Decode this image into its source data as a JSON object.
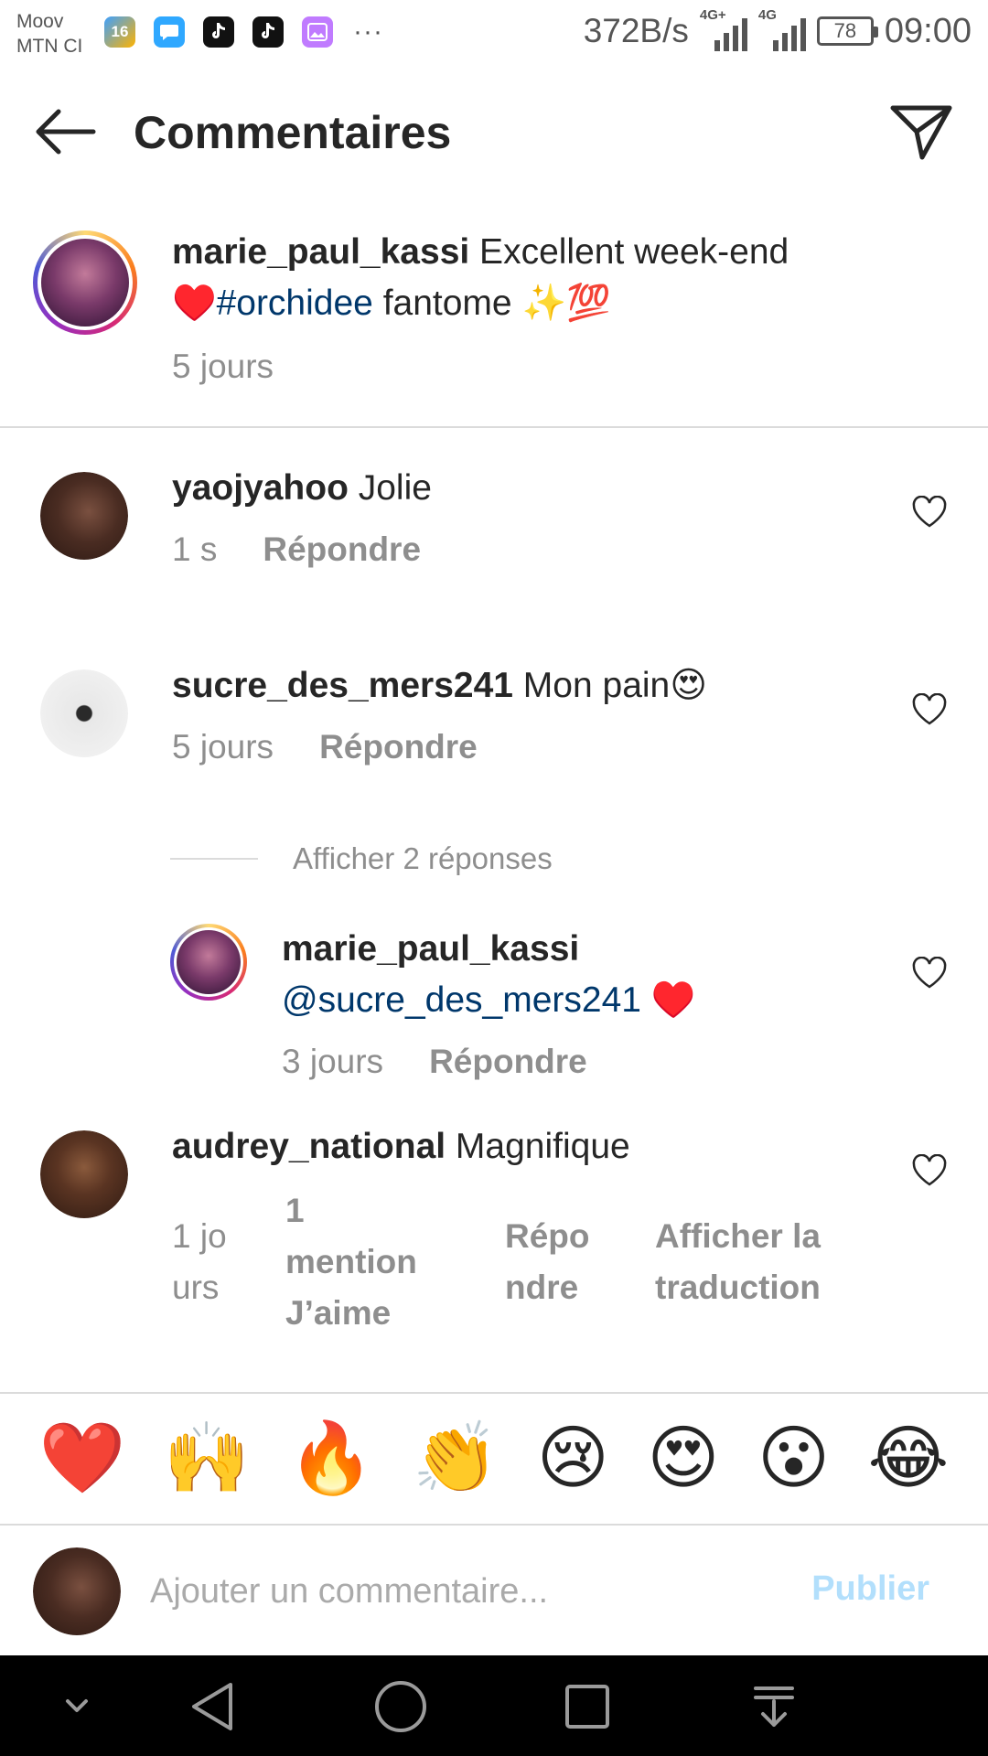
{
  "status_bar": {
    "carrier_1": "Moov",
    "carrier_2": "MTN CI",
    "app_16": "16",
    "net_speed": "372B/s",
    "net_1": "4G+",
    "net_2": "4G",
    "battery": "78",
    "time": "09:00",
    "more": "···"
  },
  "header": {
    "title": "Commentaires"
  },
  "caption": {
    "username": "marie_paul_kassi",
    "text_1": " Excellent week-end",
    "line_2_emoji": "♥️",
    "hashtag": "#orchidee",
    "text_2": " fantome ✨💯",
    "time": "5 jours"
  },
  "comments": [
    {
      "username": "yaojyahoo",
      "text": " Jolie",
      "time": "1 s",
      "reply": "Répondre"
    },
    {
      "username": "sucre_des_mers241",
      "text": " Mon pain😍",
      "time": "5 jours",
      "reply": "Répondre",
      "view_replies": "Afficher 2 réponses",
      "reply_item": {
        "username": "marie_paul_kassi",
        "mention": "@sucre_des_mers241",
        "text": " ♥️",
        "time": "3 jours",
        "reply": "Répondre"
      }
    },
    {
      "username": "audrey_national",
      "text": " Magnifique",
      "time": "1 jours",
      "likes": "1 mention J’aime",
      "reply": "Répondre",
      "translate": "Afficher la traduction"
    }
  ],
  "emoji_bar": [
    "❤️",
    "🙌",
    "🔥",
    "👏",
    "😢",
    "😍",
    "😮",
    "😂"
  ],
  "composer": {
    "placeholder": "Ajouter un commentaire...",
    "publish": "Publier"
  },
  "colors": {
    "link": "#00376b",
    "muted": "#8e8e8e",
    "publish_disabled": "#b2dffc"
  }
}
